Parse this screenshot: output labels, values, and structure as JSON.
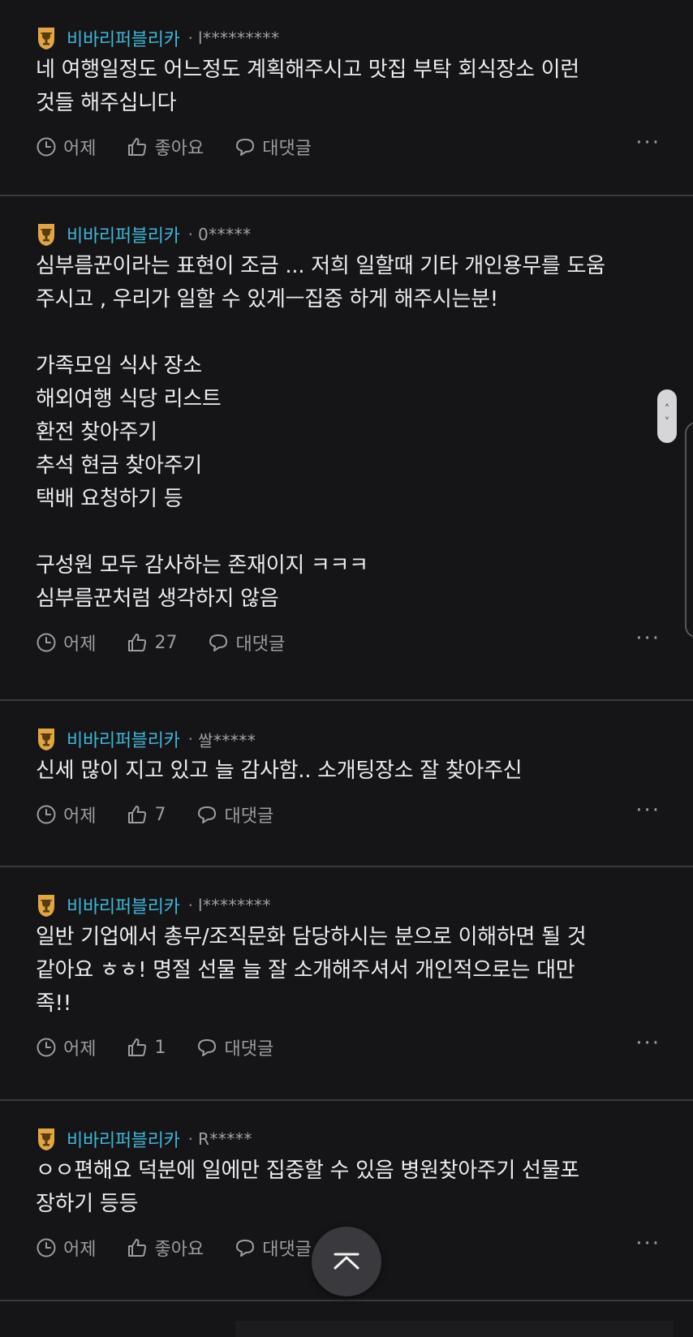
{
  "comments": [
    {
      "company": "비바리퍼블리카",
      "sep": "·",
      "nick": "l*********",
      "body": "네 여행일정도 어느정도 계획해주시고 맛집 부탁 회식장소 이런\n것들 해주십니다",
      "time": "어제",
      "likes": "좋아요",
      "reply": "대댓글",
      "more": "···"
    },
    {
      "company": "비바리퍼블리카",
      "sep": "·",
      "nick": "0*****",
      "body": "심부름꾼이라는 표현이 조금 ... 저희 일할때 기타 개인용무를 도움\n주시고 , 우리가 일할 수 있게ㅡ집중 하게 해주시는분!\n\n가족모임 식사 장소\n해외여행 식당 리스트\n환전 찾아주기\n추석 현금 찾아주기\n택배 요청하기 등\n\n구성원 모두 감사하는 존재이지 ㅋㅋㅋ\n심부름꾼처럼 생각하지 않음",
      "time": "어제",
      "likes": "27",
      "reply": "대댓글",
      "more": "···"
    },
    {
      "company": "비바리퍼블리카",
      "sep": "·",
      "nick": "쌀*****",
      "body": "신세 많이 지고 있고 늘 감사함.. 소개팅장소 잘 찾아주신",
      "time": "어제",
      "likes": "7",
      "reply": "대댓글",
      "more": "···"
    },
    {
      "company": "비바리퍼블리카",
      "sep": "·",
      "nick": "l********",
      "body": "일반 기업에서 총무/조직문화 담당하시는 분으로 이해하면 될 것\n같아요 ㅎㅎ! 명절 선물 늘 잘 소개해주셔서 개인적으로는 대만\n족!!",
      "time": "어제",
      "likes": "1",
      "reply": "대댓글",
      "more": "···"
    },
    {
      "company": "비바리퍼블리카",
      "sep": "·",
      "nick": "R*****",
      "body": "ㅇㅇ편해요 덕분에 일에만 집중할 수 있음 병원찾아주기 선물포\n장하기 등등",
      "time": "어제",
      "likes": "좋아요",
      "reply": "대댓글",
      "more": "···"
    }
  ],
  "icons": {
    "trophy": "trophy-icon",
    "clock": "clock-icon",
    "thumb": "thumbs-up-icon",
    "reply": "speech-bubble-icon",
    "top": "chevron-up-icon"
  },
  "colors": {
    "background": "#151517",
    "company": "#3fb6d8",
    "trophy": "#e0a642",
    "divider": "#3a3a3e"
  }
}
